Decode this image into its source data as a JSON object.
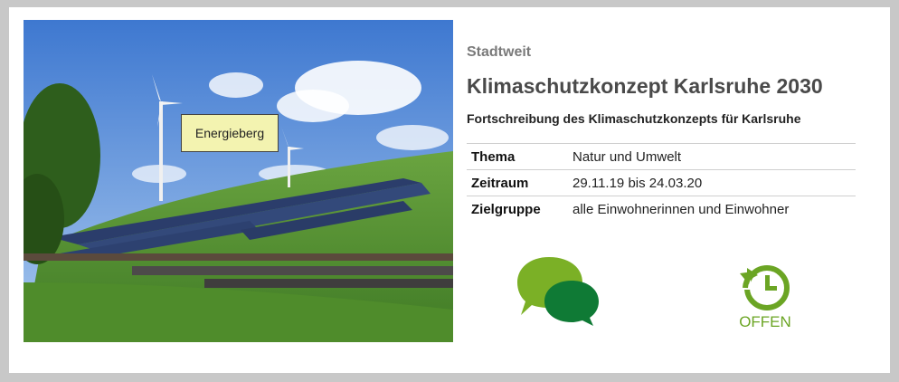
{
  "card": {
    "image_tag": "Energieberg",
    "eyebrow": "Stadtweit",
    "title": "Klimaschutzkonzept Karlsruhe 2030",
    "subtitle": "Fortschreibung des Klimaschutzkonzepts für Karlsruhe",
    "details": [
      {
        "key": "Thema",
        "value": "Natur und Umwelt"
      },
      {
        "key": "Zeitraum",
        "value": "29.11.19 bis 24.03.20"
      },
      {
        "key": "Zielgruppe",
        "value": "alle Einwohnerinnen und Einwohner"
      }
    ],
    "status_label": "OFFEN",
    "colors": {
      "green_light": "#7bb026",
      "green_dark": "#0f7a35",
      "status_green": "#6ba524"
    }
  }
}
